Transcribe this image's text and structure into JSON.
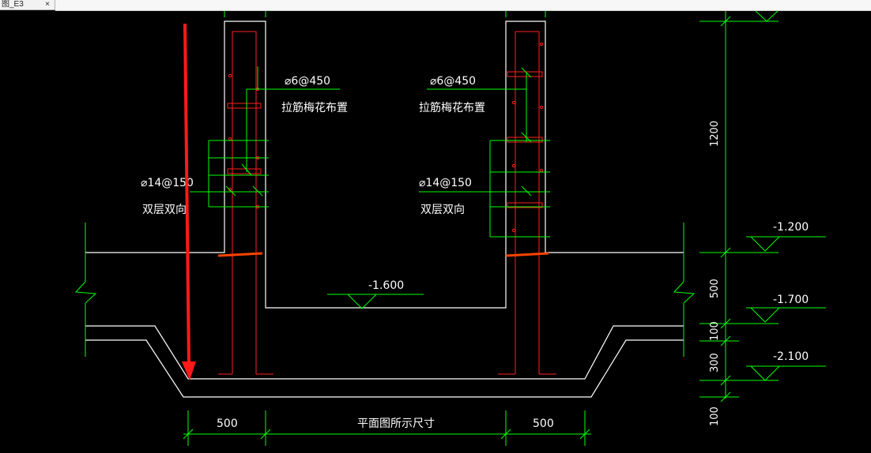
{
  "window": {
    "tab_title": "图_E3",
    "close_glyph": "×"
  },
  "left_wall": {
    "bar_spec": "⌀6@450",
    "bar_note": "拉筋梅花布置",
    "main_spec": "⌀14@150",
    "main_note": "双层双向"
  },
  "right_wall": {
    "bar_spec": "⌀6@450",
    "bar_note": "拉筋梅花布置",
    "main_spec": "⌀14@150",
    "main_note": "双层双向"
  },
  "elevations": {
    "pit_bottom": "-1.600",
    "ground": "-1.200",
    "slab_top": "-1.700",
    "slab_bottom": "-2.100"
  },
  "vertical_dims": [
    "1200",
    "500",
    "100",
    "300",
    "100"
  ],
  "bottom_dims": {
    "left": "500",
    "middle": "平面图所示尺寸",
    "right": "500"
  },
  "colors": {
    "background": "#000000",
    "outline": "#ffffff",
    "rebar": "#ff2020",
    "dimension": "#00ff00",
    "arrow": "#ff1a1a",
    "floor_mark": "#ff4400"
  }
}
